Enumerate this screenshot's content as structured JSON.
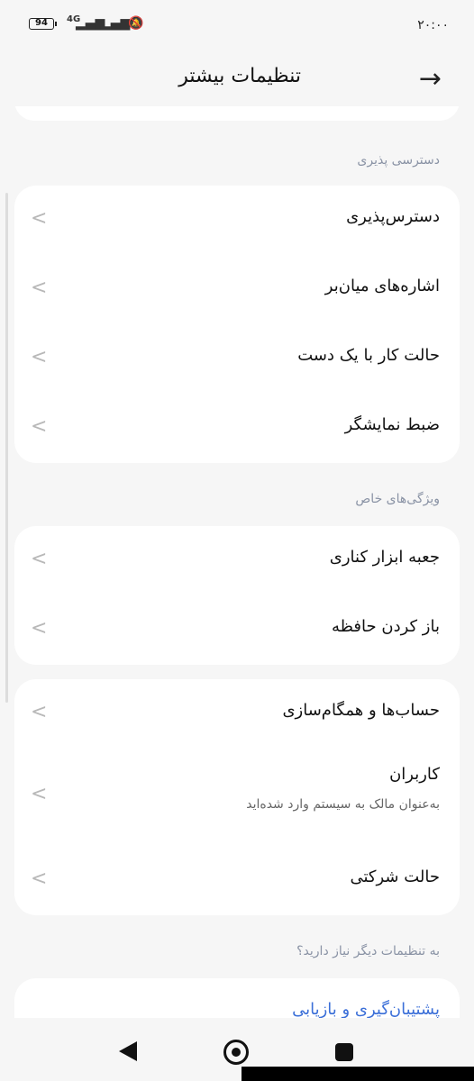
{
  "status": {
    "battery": "94",
    "network": "4G",
    "time": "۲۰:۰۰"
  },
  "header": {
    "title": "تنظیمات بیشتر"
  },
  "sections": {
    "accessibility": {
      "title": "دسترسی پذیری",
      "items": [
        "دسترس‌پذیری",
        "اشاره‌های میان‌بر",
        "حالت کار با یک دست",
        "ضبط نمایشگر"
      ]
    },
    "special": {
      "title": "ویژگی‌های خاص",
      "items": [
        "جعبه ابزار کناری",
        "باز کردن حافظه"
      ]
    },
    "accounts": {
      "items": [
        {
          "label": "حساب‌ها و همگام‌سازی"
        },
        {
          "label": "کاربران",
          "sub": "به‌عنوان مالک به سیستم وارد شده‌اید"
        },
        {
          "label": "حالت شرکتی"
        }
      ]
    },
    "more": {
      "title": "به تنظیمات دیگر نیاز دارید؟",
      "items": [
        "پشتیبان‌گیری و بازیابی"
      ]
    }
  }
}
